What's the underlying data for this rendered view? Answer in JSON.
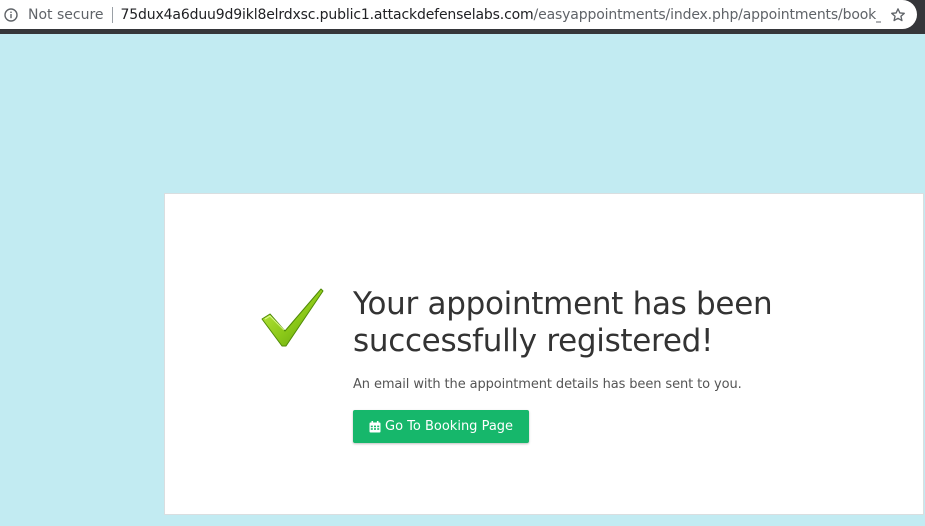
{
  "browser": {
    "security_label": "Not secure",
    "url_host": "75dux4a6duu9d9ikl8elrdxsc.public1.attackdefenselabs.com",
    "url_path": "/easyappointments/index.php/appointments/book_succes…",
    "icons": [
      "info-icon",
      "star-icon"
    ]
  },
  "page": {
    "background_color": "#c2ebf2",
    "headline": "Your appointment has been successfully registered!",
    "message": "An email with the appointment details has been sent to you.",
    "button_label": "Go To Booking Page",
    "button_color": "#16b76b",
    "icons": [
      "checkmark-icon",
      "calendar-icon"
    ]
  }
}
